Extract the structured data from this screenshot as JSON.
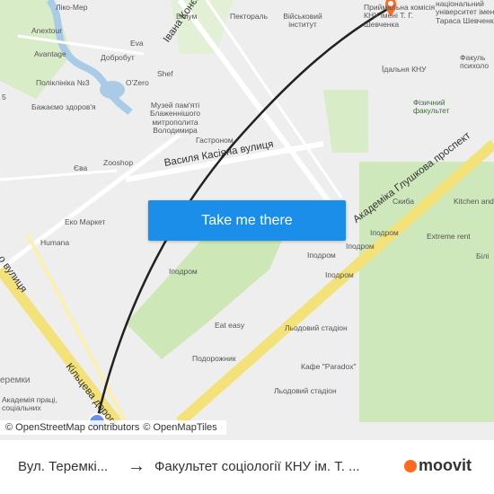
{
  "map": {
    "labels": {
      "liko_mere": "Ліко-Мер",
      "anextour": "Anextour",
      "avantage": "Avantage",
      "polyclinic": "Поліклініка №3",
      "bazhaemo": "Бажаємо здоров'я",
      "ozero": "O'Zero",
      "eva1": "Eva",
      "dobrobut": "Добробут",
      "shef": "Shef",
      "museum": "Музей пам'яті Блаженнішого митрополита Володимира",
      "vysium": "Візіум",
      "pectoral": "Пектораль",
      "military": "Військовий інститут",
      "hastronom": "Гастроном",
      "eva2": "Єва",
      "zooshop": "Zooshop",
      "eko_market": "Еко Маркет",
      "humana": "Humana",
      "ipodrom1": "Іподром",
      "ipodrom2": "Іподром",
      "ipodrom3": "Іподром",
      "ipodrom4": "Іподром",
      "ipodrom5": "Іподром",
      "skyba": "Скиба",
      "kitchen": "Kitchen and",
      "extreme": "Extreme rent",
      "eat_easy": "Eat easy",
      "stadium1": "Льодовий стадіон",
      "stadium2": "Льодовий стадіон",
      "cafe": "Кафе \"Paradox\"",
      "podorozhnyk": "Подорожник",
      "teremky": "еремки",
      "academy": "Академія праці, соціальних",
      "idalnya": "Їдальня КНУ",
      "physics": "Фізичний факультет",
      "psych": "Факуль психоло",
      "university": "національний університет імені Тараса Шевченка",
      "commission": "Приймальна комісія КНУ імені Т. Г. Шевченка",
      "num5": "5",
      "bili": "Білі"
    },
    "roads": {
      "konieva": "Івана Конєва вулиця",
      "kasiyan": "Василя Касіяна вулиця",
      "glushkov": "Академіка Глушкова проспект",
      "kiltseva": "Кільцева дорога",
      "vulytsia": "о вулиця"
    },
    "cta_label": "Take me there",
    "attribution": {
      "osm": "© OpenStreetMap contributors",
      "omt": "© OpenMapTiles"
    }
  },
  "footer": {
    "from": "Вул. Теремкі...",
    "to": "Факультет соціології КНУ ім. Т. ...",
    "brand": "moovit"
  },
  "colors": {
    "cta": "#1a8ee8",
    "route": "#222222",
    "destination_pin": "#ff6a1f",
    "origin_dot": "#6d8ff0",
    "park": "#c9e6b4",
    "major_road": "#f7e98a"
  }
}
